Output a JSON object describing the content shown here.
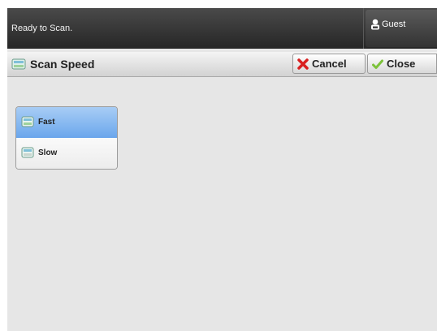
{
  "status": {
    "message": "Ready to Scan.",
    "user": {
      "label": "Guest",
      "icon": "user-icon"
    }
  },
  "header": {
    "icon": "scan-speed-icon",
    "title": "Scan Speed",
    "cancel_label": "Cancel",
    "cancel_icon": "x-icon",
    "close_label": "Close",
    "close_icon": "checkmark-icon"
  },
  "options": [
    {
      "label": "Fast",
      "icon": "fast-scan-icon",
      "selected": true
    },
    {
      "label": "Slow",
      "icon": "slow-scan-icon",
      "selected": false
    }
  ],
  "colors": {
    "status_bar": "#2e2e2e",
    "selected_option": "#7fb2ee",
    "cancel_icon": "#d92020",
    "close_icon": "#7cc23a"
  }
}
